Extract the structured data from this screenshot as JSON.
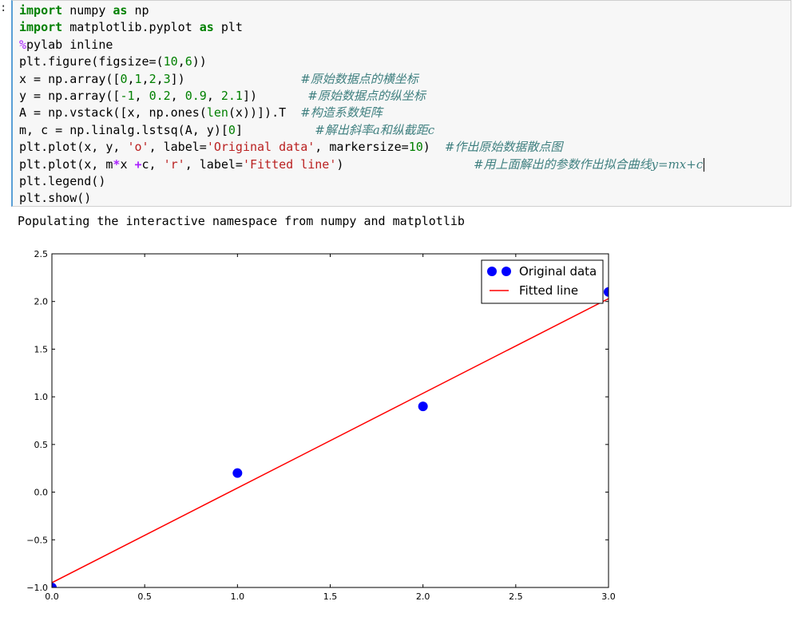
{
  "cell": {
    "prompt": ":",
    "lines": [
      [
        {
          "t": "import",
          "c": "kw"
        },
        {
          "t": " numpy "
        },
        {
          "t": "as",
          "c": "kw"
        },
        {
          "t": " np"
        }
      ],
      [
        {
          "t": "import",
          "c": "kw"
        },
        {
          "t": " matplotlib.pyplot "
        },
        {
          "t": "as",
          "c": "kw"
        },
        {
          "t": " plt"
        }
      ],
      [
        {
          "t": "%",
          "c": "magic"
        },
        {
          "t": "pylab inline"
        }
      ],
      [
        {
          "t": "plt.figure(figsize=("
        },
        {
          "t": "10",
          "c": "num"
        },
        {
          "t": ","
        },
        {
          "t": "6",
          "c": "num"
        },
        {
          "t": "))"
        }
      ],
      [
        {
          "t": "x = np.array(["
        },
        {
          "t": "0",
          "c": "num"
        },
        {
          "t": ","
        },
        {
          "t": "1",
          "c": "num"
        },
        {
          "t": ","
        },
        {
          "t": "2",
          "c": "num"
        },
        {
          "t": ","
        },
        {
          "t": "3",
          "c": "num"
        },
        {
          "t": "])                "
        },
        {
          "t": "#原始数据点的横坐标",
          "c": "cm"
        }
      ],
      [
        {
          "t": "y = np.array(["
        },
        {
          "t": "-1",
          "c": "num"
        },
        {
          "t": ", "
        },
        {
          "t": "0.2",
          "c": "num"
        },
        {
          "t": ", "
        },
        {
          "t": "0.9",
          "c": "num"
        },
        {
          "t": ", "
        },
        {
          "t": "2.1",
          "c": "num"
        },
        {
          "t": "])       "
        },
        {
          "t": "#原始数据点的纵坐标",
          "c": "cm"
        }
      ],
      [
        {
          "t": "A = np.vstack([x, np.ones("
        },
        {
          "t": "len",
          "c": "bi"
        },
        {
          "t": "(x))]).T  "
        },
        {
          "t": "#构造系数矩阵",
          "c": "cm"
        }
      ],
      [
        {
          "t": "m, c = np.linalg.lstsq(A, y)["
        },
        {
          "t": "0",
          "c": "num"
        },
        {
          "t": "]          "
        },
        {
          "t": "#解出斜率a和纵截距c",
          "c": "cm"
        }
      ],
      [
        {
          "t": "plt.plot(x, y, "
        },
        {
          "t": "'o'",
          "c": "str"
        },
        {
          "t": ", label="
        },
        {
          "t": "'Original data'",
          "c": "str"
        },
        {
          "t": ", markersize="
        },
        {
          "t": "10",
          "c": "num"
        },
        {
          "t": ")  "
        },
        {
          "t": "#作出原始数据散点图",
          "c": "cm"
        }
      ],
      [
        {
          "t": "plt.plot(x, m"
        },
        {
          "t": "*",
          "c": "op"
        },
        {
          "t": "x "
        },
        {
          "t": "+",
          "c": "op"
        },
        {
          "t": "c, "
        },
        {
          "t": "'r'",
          "c": "str"
        },
        {
          "t": ", label="
        },
        {
          "t": "'Fitted line'",
          "c": "str"
        },
        {
          "t": ")                  "
        },
        {
          "t": "#用上面解出的参数作出拟合曲线y=mx+c",
          "c": "cm"
        }
      ],
      [
        {
          "t": "plt.legend()"
        }
      ],
      [
        {
          "t": "plt.show()"
        }
      ]
    ]
  },
  "output_text": "Populating the interactive namespace from numpy and matplotlib",
  "chart_data": {
    "type": "scatter",
    "xlim": [
      0,
      3
    ],
    "ylim": [
      -1,
      2.5
    ],
    "x_ticks": [
      "0.0",
      "0.5",
      "1.0",
      "1.5",
      "2.0",
      "2.5",
      "3.0"
    ],
    "y_ticks": [
      "−1.0",
      "−0.5",
      "0.0",
      "0.5",
      "1.0",
      "1.5",
      "2.0",
      "2.5"
    ],
    "series": [
      {
        "name": "Original data",
        "kind": "points",
        "color": "#0000ff",
        "x": [
          0,
          1,
          2,
          3
        ],
        "y": [
          -1,
          0.2,
          0.9,
          2.1
        ]
      },
      {
        "name": "Fitted line",
        "kind": "line",
        "color": "#ff0000",
        "x": [
          0,
          3
        ],
        "y": [
          -0.95,
          2.03
        ]
      }
    ],
    "legend_position": "top-right",
    "grid": false
  }
}
